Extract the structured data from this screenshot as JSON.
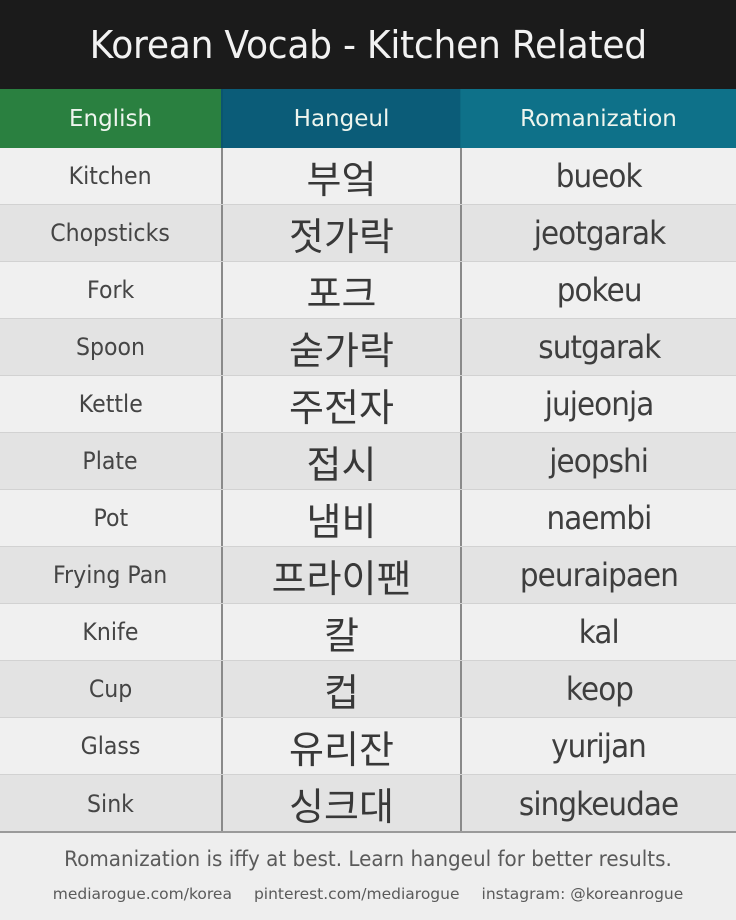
{
  "title": "Korean Vocab - Kitchen Related",
  "colors": {
    "title_bg": "#1b1b1b",
    "english_header": "#2a8040",
    "hangeul_header": "#0b5c78",
    "romanization_header": "#0e7189",
    "row_light": "#f0f0f0",
    "row_dark": "#e3e3e3"
  },
  "table": {
    "headers": [
      "English",
      "Hangeul",
      "Romanization"
    ],
    "rows": [
      {
        "english": "Kitchen",
        "hangeul": "부엌",
        "romanization": "bueok"
      },
      {
        "english": "Chopsticks",
        "hangeul": "젓가락",
        "romanization": "jeotgarak"
      },
      {
        "english": "Fork",
        "hangeul": "포크",
        "romanization": "pokeu"
      },
      {
        "english": "Spoon",
        "hangeul": "숟가락",
        "romanization": "sutgarak"
      },
      {
        "english": "Kettle",
        "hangeul": "주전자",
        "romanization": "jujeonja"
      },
      {
        "english": "Plate",
        "hangeul": "접시",
        "romanization": "jeopshi"
      },
      {
        "english": "Pot",
        "hangeul": "냄비",
        "romanization": "naembi"
      },
      {
        "english": "Frying Pan",
        "hangeul": "프라이팬",
        "romanization": "peuraipaen"
      },
      {
        "english": "Knife",
        "hangeul": "칼",
        "romanization": "kal"
      },
      {
        "english": "Cup",
        "hangeul": "컵",
        "romanization": "keop"
      },
      {
        "english": "Glass",
        "hangeul": "유리잔",
        "romanization": "yurijan"
      },
      {
        "english": "Sink",
        "hangeul": "싱크대",
        "romanization": "singkeudae"
      }
    ]
  },
  "footer": {
    "note": "Romanization is iffy at best. Learn hangeul for better results.",
    "links": [
      "mediarogue.com/korea",
      "pinterest.com/mediarogue",
      "instagram: @koreanrogue"
    ]
  }
}
